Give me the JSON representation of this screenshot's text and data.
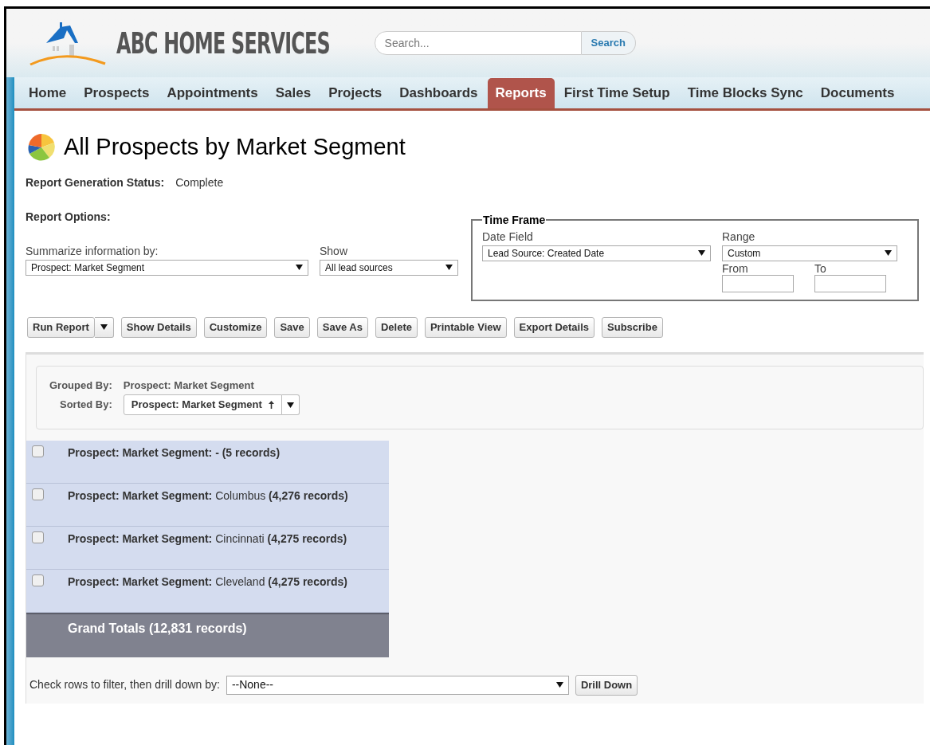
{
  "header": {
    "brand": "ABC HOME SERVICES",
    "search": {
      "placeholder": "Search...",
      "button": "Search"
    }
  },
  "tabs": [
    {
      "label": "Home",
      "selected": false
    },
    {
      "label": "Prospects",
      "selected": false
    },
    {
      "label": "Appointments",
      "selected": false
    },
    {
      "label": "Sales",
      "selected": false
    },
    {
      "label": "Projects",
      "selected": false
    },
    {
      "label": "Dashboards",
      "selected": false
    },
    {
      "label": "Reports",
      "selected": true
    },
    {
      "label": "First Time Setup",
      "selected": false
    },
    {
      "label": "Time Blocks Sync",
      "selected": false
    },
    {
      "label": "Documents",
      "selected": false
    }
  ],
  "page_title": "All Prospects by Market Segment",
  "status": {
    "label": "Report Generation Status:",
    "value": "Complete"
  },
  "options": {
    "heading": "Report Options:",
    "summarize": {
      "label": "Summarize information by:",
      "value": "Prospect: Market Segment"
    },
    "show": {
      "label": "Show",
      "value": "All lead sources"
    }
  },
  "time_frame": {
    "legend": "Time Frame",
    "date_field": {
      "label": "Date Field",
      "value": "Lead Source: Created Date"
    },
    "range": {
      "label": "Range",
      "value": "Custom"
    },
    "from": {
      "label": "From"
    },
    "to": {
      "label": "To"
    }
  },
  "actions": [
    {
      "label": "Run Report",
      "kind": "split"
    },
    {
      "label": "Show Details",
      "kind": "plain"
    },
    {
      "label": "Customize",
      "kind": "plain"
    },
    {
      "label": "Save",
      "kind": "plain"
    },
    {
      "label": "Save As",
      "kind": "plain"
    },
    {
      "label": "Delete",
      "kind": "plain"
    },
    {
      "label": "Printable View",
      "kind": "plain"
    },
    {
      "label": "Export Details",
      "kind": "plain"
    },
    {
      "label": "Subscribe",
      "kind": "plain"
    }
  ],
  "grouping": {
    "grouped_label": "Grouped By:",
    "grouped_value": "Prospect: Market Segment",
    "sorted_label": "Sorted By:",
    "sorted_value": "Prospect: Market Segment"
  },
  "rows": [
    {
      "text": "**Prospect: Market Segment: - (5 records)**",
      "checked": false
    },
    {
      "text": "**Prospect: Market Segment:** Columbus **(4,276 records)**",
      "checked": false
    },
    {
      "text": "**Prospect: Market Segment:** Cincinnati **(4,275 records)**",
      "checked": false
    },
    {
      "text": "**Prospect: Market Segment:** Cleveland **(4,275 records)**",
      "checked": false
    }
  ],
  "grand_total": "Grand Totals (12,831 records)",
  "drill": {
    "label": "Check rows to filter, then drill down by:",
    "value": "--None--",
    "button": "Drill Down"
  }
}
